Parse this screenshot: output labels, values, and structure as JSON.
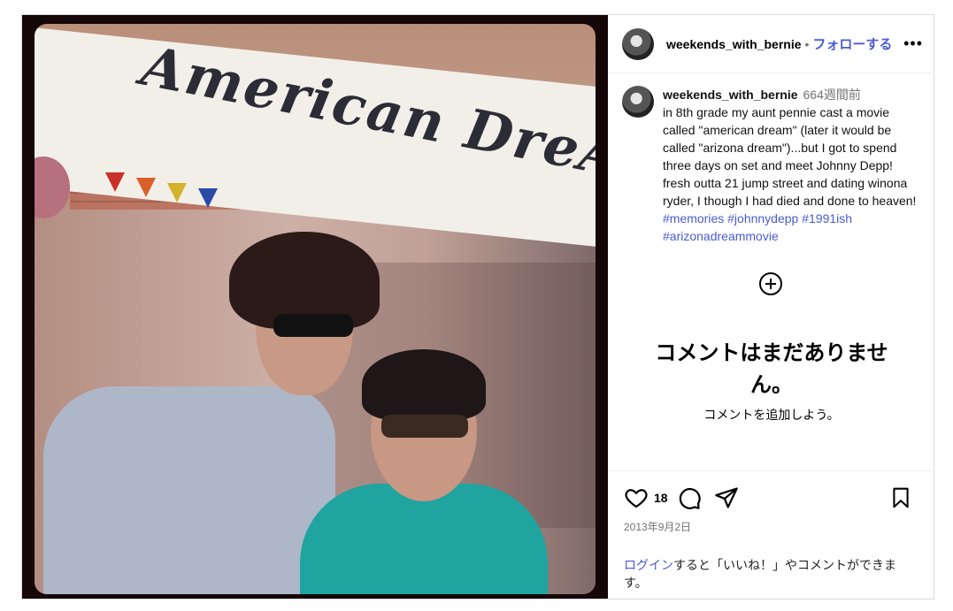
{
  "header": {
    "username": "weekends_with_bernie",
    "separator": "•",
    "follow_label": "フォローする",
    "more_label": "•••"
  },
  "caption": {
    "username": "weekends_with_bernie",
    "time": "664週間前",
    "text": "in 8th grade my aunt pennie cast a movie called \"american dream\" (later it would be called \"arizona dream\")...but I got to spend three days on set and meet Johnny Depp! fresh outta 21 jump street and dating winona ryder, I though I had died and done to heaven! ",
    "hashtags": [
      "#memories",
      "#johnnydepp",
      "#1991ish",
      "#arizonadreammovie"
    ]
  },
  "photo": {
    "banner_text": "American DreAm"
  },
  "comments": {
    "empty_title": "コメントはまだありません。",
    "empty_subtitle": "コメントを追加しよう。"
  },
  "actions": {
    "like_count": "18",
    "date": "2013年9月2日"
  },
  "login": {
    "link": "ログイン",
    "rest": "すると「いいね！」やコメントができます。"
  },
  "icons": {
    "follow_color": "#4a5bd3"
  }
}
